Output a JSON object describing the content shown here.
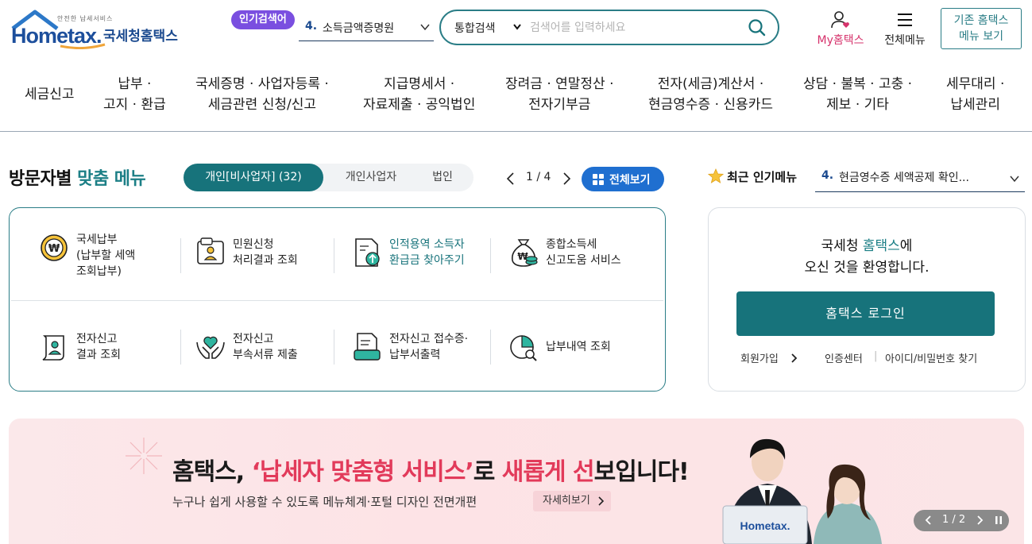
{
  "header": {
    "logo": {
      "small_text": "안전한 납세서비스",
      "word": "Hometax.",
      "name": "국세청홈택스"
    },
    "popular": {
      "badge": "인기검색어",
      "rank": "4.",
      "keyword": "소득금액증명원"
    },
    "search": {
      "scope": "통합검색",
      "placeholder": "검색어를 입력하세요"
    },
    "my_hometax": "My홈택스",
    "all_menu": "전체메뉴",
    "classic_btn_line1": "기존 홈택스",
    "classic_btn_line2": "메뉴 보기"
  },
  "gnb": [
    {
      "line1": "세금신고",
      "line2": ""
    },
    {
      "line1": "납부 ·",
      "line2": "고지 · 환급"
    },
    {
      "line1": "국세증명 · 사업자등록 ·",
      "line2": "세금관련 신청/신고"
    },
    {
      "line1": "지급명세서 ·",
      "line2": "자료제출 · 공익법인"
    },
    {
      "line1": "장려금 · 연말정산 ·",
      "line2": "전자기부금"
    },
    {
      "line1": "전자(세금)계산서 ·",
      "line2": "현금영수증 · 신용카드"
    },
    {
      "line1": "상담 · 불복 · 고충 ·",
      "line2": "제보 · 기타"
    },
    {
      "line1": "세무대리 ·",
      "line2": "납세관리"
    }
  ],
  "visitor_menu": {
    "title_prefix": "방문자별",
    "title_highlight": "맞춤 메뉴",
    "tabs": [
      "개인[비사업자] (32)",
      "개인사업자",
      "법인"
    ],
    "active_tab": 0,
    "pager": "1 / 4",
    "all_view": "전체보기",
    "services": [
      {
        "icon": "won-coin-icon",
        "lines": [
          "국세납부",
          "(납부할 세액",
          "조회납부)"
        ],
        "highlight": false
      },
      {
        "icon": "document-person-icon",
        "lines": [
          "민원신청",
          "처리결과 조회"
        ],
        "highlight": false
      },
      {
        "icon": "document-refund-icon",
        "lines": [
          "인적용역 소득자",
          "환급금 찾아주기"
        ],
        "highlight": true
      },
      {
        "icon": "money-bag-icon",
        "lines": [
          "종합소득세",
          "신고도움 서비스"
        ],
        "highlight": false
      },
      {
        "icon": "scroll-person-icon",
        "lines": [
          "전자신고",
          "결과 조회"
        ],
        "highlight": false
      },
      {
        "icon": "hands-heart-icon",
        "lines": [
          "전자신고",
          "부속서류 제출"
        ],
        "highlight": false
      },
      {
        "icon": "document-print-icon",
        "lines": [
          "전자신고 접수증·",
          "납부서출력"
        ],
        "highlight": false
      },
      {
        "icon": "pie-search-icon",
        "lines": [
          "납부내역 조회"
        ],
        "highlight": false
      }
    ]
  },
  "recent_menu": {
    "title": "최근 인기메뉴",
    "rank": "4.",
    "keyword": "현금영수증 세액공제 확인..."
  },
  "login": {
    "welcome_pre": "국세청 ",
    "welcome_hl": "홈택스",
    "welcome_post": "에",
    "welcome_line2": "오신 것을 환영합니다.",
    "button": "홈택스 로그인",
    "join": "회원가입",
    "cert": "인증센터",
    "find": "아이디/비밀번호 찾기"
  },
  "banner": {
    "headline_a": "홈택스, ",
    "headline_b": "‘납세자 맞춤형 서비스’",
    "headline_c": "로 ",
    "headline_d": "새롭게 선",
    "headline_e": "보입니다!",
    "sub": "누구나 쉽게 사용할 수 있도록 메뉴체계·포털 디자인 전면개편",
    "more": "자세히보기",
    "pager": "1 / 2",
    "laptop_word": "Hometax."
  },
  "colors": {
    "teal": "#17737b",
    "blue": "#1f6fd0",
    "navy": "#1b4a8f",
    "purple": "#7a4fe0",
    "pink": "#d6336c",
    "banner_red": "#e23a5a"
  }
}
